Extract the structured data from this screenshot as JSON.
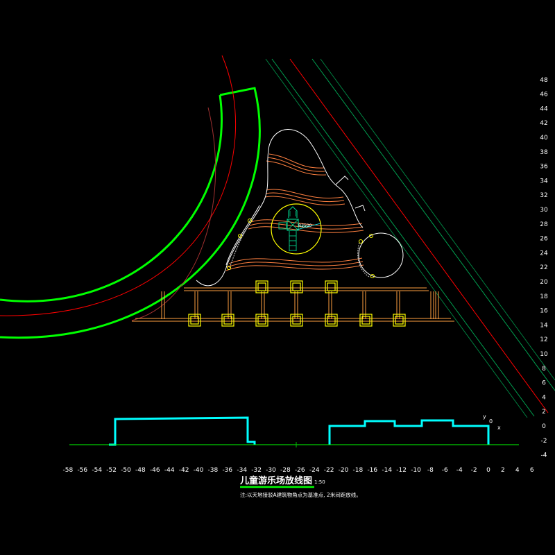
{
  "drawing": {
    "title": "儿童游乐场放线图",
    "scale": "1:50",
    "note": "注:以天地接驳A建筑物角点为基准点, 2米间距放线。",
    "dimension_label": "R3500",
    "axis_y_label": "y",
    "axis_origin_label": "0",
    "axis_x_label": "x"
  },
  "grid": {
    "x_ticks": [
      -58,
      -56,
      -54,
      -52,
      -50,
      -48,
      -46,
      -44,
      -42,
      -40,
      -38,
      -36,
      -34,
      -32,
      -30,
      -28,
      -26,
      -24,
      -22,
      -20,
      -18,
      -16,
      -14,
      -12,
      -10,
      -8,
      -6,
      -4,
      -2,
      0,
      2,
      4,
      6
    ],
    "y_ticks": [
      48,
      46,
      44,
      42,
      40,
      38,
      36,
      34,
      32,
      30,
      28,
      26,
      24,
      22,
      20,
      18,
      16,
      14,
      12,
      10,
      8,
      6,
      4,
      2,
      0,
      -2,
      -4
    ]
  },
  "colors": {
    "background": "#000000",
    "path_edge": "#00ff00",
    "road_center": "#ff0000",
    "boundary_green": "#00a050",
    "building": "#00ffff",
    "pergola": "#ffa040",
    "pergola_column": "#ffff00",
    "wave_band": "#ff8040",
    "play_outline": "#ffffff",
    "equipment_circle": "#ffff00",
    "equipment": "#00c080"
  }
}
